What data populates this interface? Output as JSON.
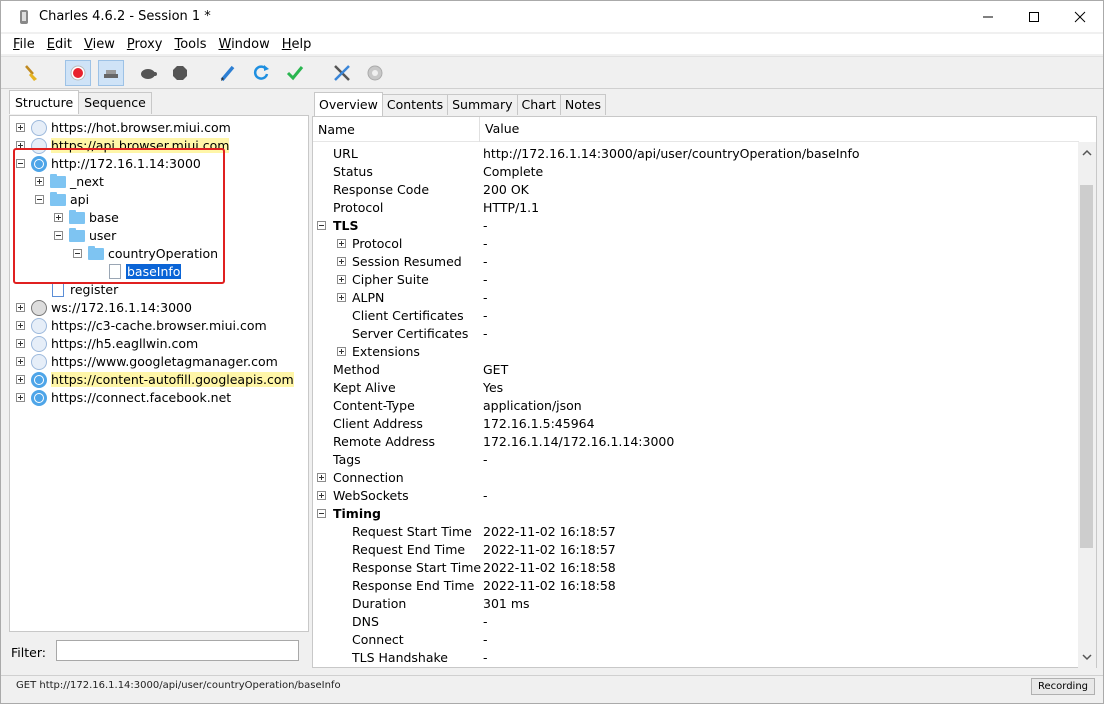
{
  "window": {
    "title": "Charles 4.6.2 - Session 1 *"
  },
  "menu": [
    {
      "m": "F",
      "rest": "ile"
    },
    {
      "m": "E",
      "rest": "dit"
    },
    {
      "m": "V",
      "rest": "iew"
    },
    {
      "m": "P",
      "rest": "roxy"
    },
    {
      "m": "T",
      "rest": "ools"
    },
    {
      "m": "W",
      "rest": "indow"
    },
    {
      "m": "H",
      "rest": "elp"
    }
  ],
  "toolbar": {
    "items": [
      "broom-icon",
      "record-icon",
      "throttle-icon",
      "turtle-icon",
      "stop-icon",
      "pen-icon",
      "refresh-icon",
      "check-icon",
      "tools-icon",
      "gear-icon"
    ]
  },
  "left": {
    "tabs": [
      "Structure",
      "Sequence"
    ],
    "tree": [
      {
        "label": "https://hot.browser.miui.com"
      },
      {
        "label": "https://api.browser.miui.com"
      },
      {
        "label": "http://172.16.1.14:3000"
      },
      {
        "label": "_next"
      },
      {
        "label": "api"
      },
      {
        "label": "base"
      },
      {
        "label": "user"
      },
      {
        "label": "countryOperation"
      },
      {
        "label": "baseInfo"
      },
      {
        "label": "register"
      },
      {
        "label": "ws://172.16.1.14:3000"
      },
      {
        "label": "https://c3-cache.browser.miui.com"
      },
      {
        "label": "https://h5.eagllwin.com"
      },
      {
        "label": "https://www.googletagmanager.com"
      },
      {
        "label": "https://content-autofill.googleapis.com"
      },
      {
        "label": "https://connect.facebook.net"
      }
    ],
    "filter_label": "Filter:",
    "filter_value": ""
  },
  "right": {
    "tabs": [
      "Overview",
      "Contents",
      "Summary",
      "Chart",
      "Notes"
    ],
    "header": {
      "name": "Name",
      "value": "Value"
    },
    "rows": [
      {
        "name": "URL",
        "value": "http://172.16.1.14:3000/api/user/countryOperation/baseInfo"
      },
      {
        "name": "Status",
        "value": "Complete"
      },
      {
        "name": "Response Code",
        "value": "200 OK"
      },
      {
        "name": "Protocol",
        "value": "HTTP/1.1"
      },
      {
        "name": "TLS",
        "value": "-"
      },
      {
        "name": "Protocol",
        "value": "-"
      },
      {
        "name": "Session Resumed",
        "value": "-"
      },
      {
        "name": "Cipher Suite",
        "value": "-"
      },
      {
        "name": "ALPN",
        "value": "-"
      },
      {
        "name": "Client Certificates",
        "value": "-"
      },
      {
        "name": "Server Certificates",
        "value": "-"
      },
      {
        "name": "Extensions",
        "value": ""
      },
      {
        "name": "Method",
        "value": "GET"
      },
      {
        "name": "Kept Alive",
        "value": "Yes"
      },
      {
        "name": "Content-Type",
        "value": "application/json"
      },
      {
        "name": "Client Address",
        "value": "172.16.1.5:45964"
      },
      {
        "name": "Remote Address",
        "value": "172.16.1.14/172.16.1.14:3000"
      },
      {
        "name": "Tags",
        "value": "-"
      },
      {
        "name": "Connection",
        "value": ""
      },
      {
        "name": "WebSockets",
        "value": "-"
      },
      {
        "name": "Timing",
        "value": ""
      },
      {
        "name": "Request Start Time",
        "value": "2022-11-02 16:18:57"
      },
      {
        "name": "Request End Time",
        "value": "2022-11-02 16:18:57"
      },
      {
        "name": "Response Start Time",
        "value": "2022-11-02 16:18:58"
      },
      {
        "name": "Response End Time",
        "value": "2022-11-02 16:18:58"
      },
      {
        "name": "Duration",
        "value": "301 ms"
      },
      {
        "name": "DNS",
        "value": "-"
      },
      {
        "name": "Connect",
        "value": "-"
      },
      {
        "name": "TLS Handshake",
        "value": "-"
      }
    ]
  },
  "status": {
    "text": "GET http://172.16.1.14:3000/api/user/countryOperation/baseInfo",
    "badge": "Recording"
  }
}
